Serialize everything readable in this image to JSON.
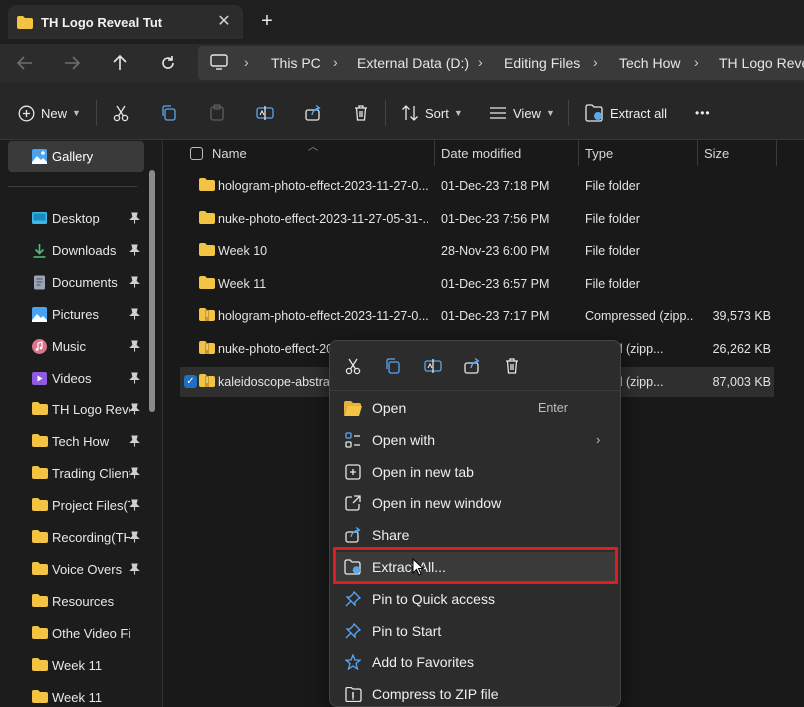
{
  "window": {
    "tab_title": "TH Logo Reveal Tut",
    "tab_close": "✕",
    "new_tab": "+"
  },
  "breadcrumbs": [
    "This PC",
    "External Data (D:)",
    "Editing Files",
    "Tech How",
    "TH Logo Reveal Tut"
  ],
  "toolbar": {
    "new_label": "New",
    "sort_label": "Sort",
    "view_label": "View",
    "extract_all_label": "Extract all",
    "more_label": "•••"
  },
  "sidebar": {
    "gallery_label": "Gallery",
    "items": [
      {
        "label": "Desktop",
        "icon": "desktop-icon",
        "pinned": true
      },
      {
        "label": "Downloads",
        "icon": "download-icon",
        "pinned": true
      },
      {
        "label": "Documents",
        "icon": "document-icon",
        "pinned": true
      },
      {
        "label": "Pictures",
        "icon": "pictures-icon",
        "pinned": true
      },
      {
        "label": "Music",
        "icon": "music-icon",
        "pinned": true
      },
      {
        "label": "Videos",
        "icon": "videos-icon",
        "pinned": true
      },
      {
        "label": "TH Logo Reveal Tut",
        "icon": "folder-icon",
        "pinned": true
      },
      {
        "label": "Tech How",
        "icon": "folder-icon",
        "pinned": true
      },
      {
        "label": "Trading Client",
        "icon": "folder-icon",
        "pinned": true
      },
      {
        "label": "Project Files(TH)",
        "icon": "folder-icon",
        "pinned": true
      },
      {
        "label": "Recording(TH)",
        "icon": "folder-icon",
        "pinned": true
      },
      {
        "label": "Voice Overs",
        "icon": "folder-icon",
        "pinned": true
      },
      {
        "label": "Resources",
        "icon": "folder-icon",
        "pinned": false
      },
      {
        "label": "Othe Video Files",
        "icon": "folder-icon",
        "pinned": false
      },
      {
        "label": "Week 11",
        "icon": "folder-icon",
        "pinned": false
      },
      {
        "label": "Week 11",
        "icon": "folder-icon",
        "pinned": false
      }
    ]
  },
  "columns": {
    "name": "Name",
    "date": "Date modified",
    "type": "Type",
    "size": "Size"
  },
  "files": [
    {
      "name": "hologram-photo-effect-2023-11-27-0...",
      "date": "01-Dec-23 7:18 PM",
      "type": "File folder",
      "size": "",
      "kind": "folder",
      "selected": false
    },
    {
      "name": "nuke-photo-effect-2023-11-27-05-31-...",
      "date": "01-Dec-23 7:56 PM",
      "type": "File folder",
      "size": "",
      "kind": "folder",
      "selected": false
    },
    {
      "name": "Week 10",
      "date": "28-Nov-23 6:00 PM",
      "type": "File folder",
      "size": "",
      "kind": "folder",
      "selected": false
    },
    {
      "name": "Week 11",
      "date": "01-Dec-23 6:57 PM",
      "type": "File folder",
      "size": "",
      "kind": "folder",
      "selected": false
    },
    {
      "name": "hologram-photo-effect-2023-11-27-0...",
      "date": "01-Dec-23 7:17 PM",
      "type": "Compressed (zipp...",
      "size": "39,573 KB",
      "kind": "zip",
      "selected": false
    },
    {
      "name": "nuke-photo-effect-20",
      "date": "",
      "type": "ressed (zipp...",
      "size": "26,262 KB",
      "kind": "zip",
      "selected": false
    },
    {
      "name": "kaleidoscope-abstrac",
      "date": "",
      "type": "ressed (zipp...",
      "size": "87,003 KB",
      "kind": "zip",
      "selected": true
    }
  ],
  "context_menu": {
    "quick_icons": [
      "cut-icon",
      "copy-icon",
      "rename-icon",
      "share-icon",
      "delete-icon"
    ],
    "items": [
      {
        "label": "Open",
        "icon": "folder-open-icon",
        "accel": "Enter",
        "submenu": false
      },
      {
        "label": "Open with",
        "icon": "open-with-icon",
        "accel": "",
        "submenu": true
      },
      {
        "label": "Open in new tab",
        "icon": "new-tab-icon",
        "accel": "",
        "submenu": false
      },
      {
        "label": "Open in new window",
        "icon": "new-window-icon",
        "accel": "",
        "submenu": false
      },
      {
        "label": "Share",
        "icon": "share-icon",
        "accel": "",
        "submenu": false
      },
      {
        "label": "Extract All...",
        "icon": "extract-icon",
        "accel": "",
        "submenu": false
      },
      {
        "label": "Pin to Quick access",
        "icon": "pin-icon",
        "accel": "",
        "submenu": false
      },
      {
        "label": "Pin to Start",
        "icon": "pin-icon",
        "accel": "",
        "submenu": false
      },
      {
        "label": "Add to Favorites",
        "icon": "star-icon",
        "accel": "",
        "submenu": false
      },
      {
        "label": "Compress to ZIP file",
        "icon": "zip-icon",
        "accel": "",
        "submenu": false
      }
    ],
    "highlighted": "Extract All..."
  },
  "colors": {
    "folder": "#f3c343",
    "accent": "#1f6fc4",
    "highlight_box": "#e21b22"
  }
}
